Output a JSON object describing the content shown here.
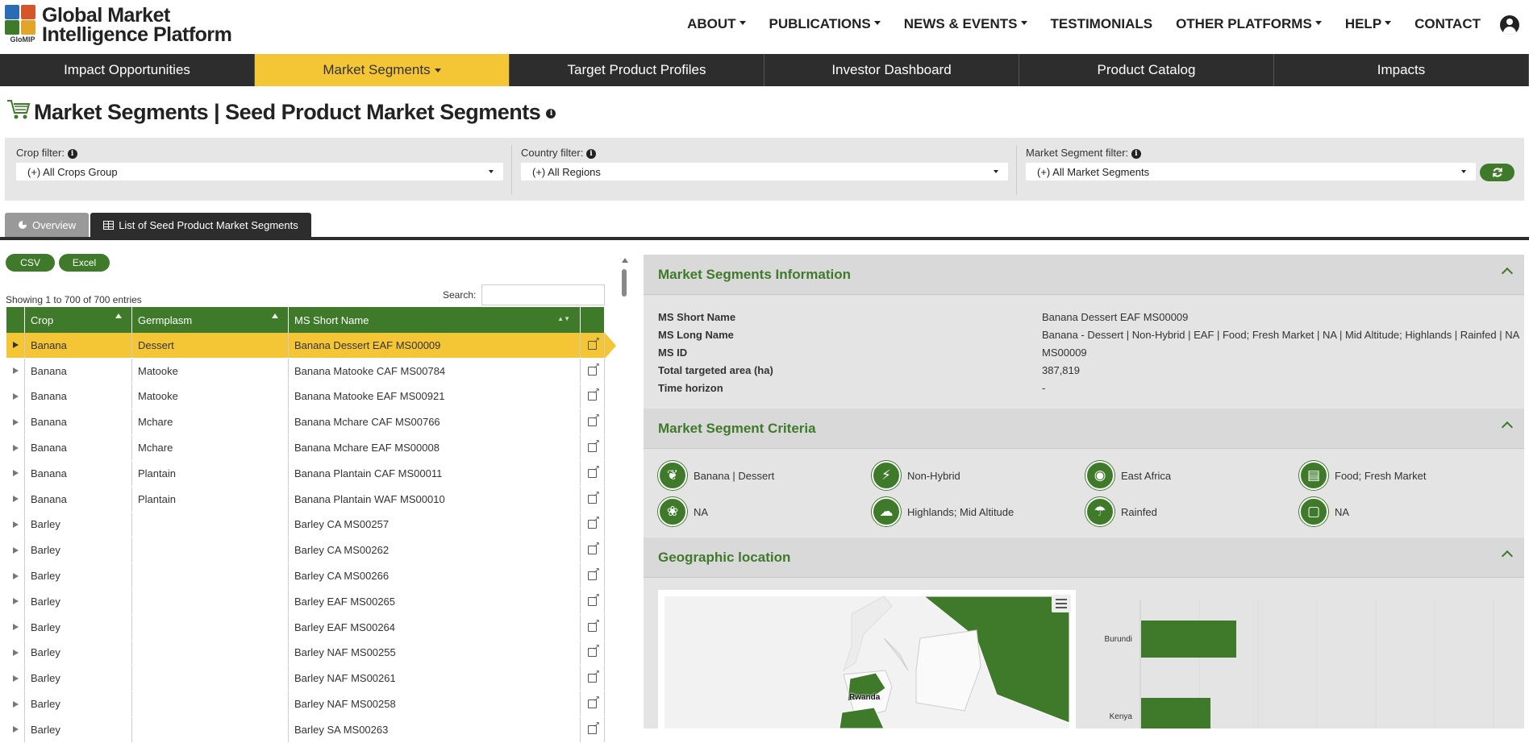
{
  "brand": {
    "logo_text": "GloMIP",
    "line1": "Global Market",
    "line2": "Intelligence Platform"
  },
  "topnav": [
    {
      "label": "ABOUT",
      "dropdown": true
    },
    {
      "label": "PUBLICATIONS",
      "dropdown": true
    },
    {
      "label": "NEWS & EVENTS",
      "dropdown": true
    },
    {
      "label": "TESTIMONIALS",
      "dropdown": false
    },
    {
      "label": "OTHER PLATFORMS",
      "dropdown": true
    },
    {
      "label": "HELP",
      "dropdown": true
    },
    {
      "label": "CONTACT",
      "dropdown": false
    }
  ],
  "subnav": [
    "Impact Opportunities",
    "Market Segments",
    "Target Product Profiles",
    "Investor Dashboard",
    "Product Catalog",
    "Impacts"
  ],
  "subnav_active": "Market Segments",
  "page_title": "Market Segments | Seed Product Market Segments",
  "filters": {
    "crop": {
      "label": "Crop filter:",
      "value": "(+) All Crops Group"
    },
    "country": {
      "label": "Country filter:",
      "value": "(+) All Regions"
    },
    "segment": {
      "label": "Market Segment filter:",
      "value": "(+) All Market Segments"
    }
  },
  "tabs": {
    "overview": "Overview",
    "list": "List of Seed Product Market Segments"
  },
  "table": {
    "csv": "CSV",
    "excel": "Excel",
    "showing": "Showing 1 to 700 of 700 entries",
    "search_label": "Search:",
    "headers": [
      "Crop",
      "Germplasm",
      "MS Short Name"
    ],
    "rows": [
      [
        "Banana",
        "Dessert",
        "Banana Dessert EAF MS00009"
      ],
      [
        "Banana",
        "Matooke",
        "Banana Matooke CAF MS00784"
      ],
      [
        "Banana",
        "Matooke",
        "Banana Matooke EAF MS00921"
      ],
      [
        "Banana",
        "Mchare",
        "Banana Mchare CAF MS00766"
      ],
      [
        "Banana",
        "Mchare",
        "Banana Mchare EAF MS00008"
      ],
      [
        "Banana",
        "Plantain",
        "Banana Plantain CAF MS00011"
      ],
      [
        "Banana",
        "Plantain",
        "Banana Plantain WAF MS00010"
      ],
      [
        "Barley",
        "",
        "Barley CA MS00257"
      ],
      [
        "Barley",
        "",
        "Barley CA MS00262"
      ],
      [
        "Barley",
        "",
        "Barley CA MS00266"
      ],
      [
        "Barley",
        "",
        "Barley EAF MS00265"
      ],
      [
        "Barley",
        "",
        "Barley EAF MS00264"
      ],
      [
        "Barley",
        "",
        "Barley NAF MS00255"
      ],
      [
        "Barley",
        "",
        "Barley NAF MS00261"
      ],
      [
        "Barley",
        "",
        "Barley NAF MS00258"
      ],
      [
        "Barley",
        "",
        "Barley SA MS00263"
      ]
    ]
  },
  "info": {
    "heading": "Market Segments Information",
    "fields": [
      {
        "k": "MS Short Name",
        "v": "Banana Dessert EAF MS00009"
      },
      {
        "k": "MS Long Name",
        "v": "Banana - Dessert | Non-Hybrid | EAF | Food; Fresh Market | NA | Mid Altitude; Highlands | Rainfed | NA"
      },
      {
        "k": "MS ID",
        "v": "MS00009"
      },
      {
        "k": "Total targeted area (ha)",
        "v": "387,819"
      },
      {
        "k": "Time horizon",
        "v": "-"
      }
    ]
  },
  "criteria": {
    "heading": "Market Segment Criteria",
    "items": [
      {
        "icon": "grain-icon",
        "label": "Banana | Dessert"
      },
      {
        "icon": "lightning-icon",
        "label": "Non-Hybrid"
      },
      {
        "icon": "globe-icon",
        "label": "East Africa"
      },
      {
        "icon": "market-icon",
        "label": "Food; Fresh Market"
      },
      {
        "icon": "palette-icon",
        "label": "NA"
      },
      {
        "icon": "weather-icon",
        "label": "Highlands; Mid Altitude"
      },
      {
        "icon": "rain-icon",
        "label": "Rainfed"
      },
      {
        "icon": "calendar-icon",
        "label": "NA"
      }
    ]
  },
  "geo": {
    "heading": "Geographic location",
    "map_label": "Rwanda",
    "bar_labels": [
      "Burundi",
      "Kenya"
    ]
  },
  "colors": {
    "green": "#3f7a2b",
    "yellow": "#f4c535",
    "dark": "#2d2d2d"
  }
}
